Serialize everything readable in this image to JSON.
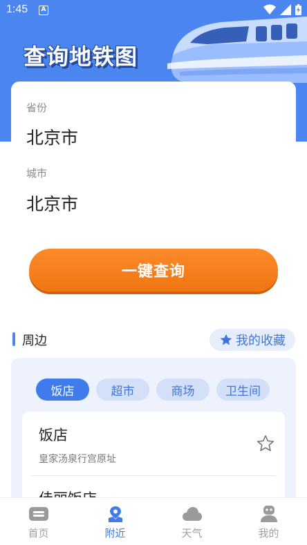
{
  "status_bar": {
    "time": "1:45",
    "a_label": "A"
  },
  "hero": {
    "title": "查询地铁图"
  },
  "form": {
    "province": {
      "label": "省份",
      "value": "北京市"
    },
    "city": {
      "label": "城市",
      "value": "北京市"
    },
    "query_button": "一键查询"
  },
  "nearby": {
    "title": "周边",
    "favorites_label": "我的收藏",
    "chips": [
      "饭店",
      "超市",
      "商场",
      "卫生间"
    ],
    "active_chip": "饭店",
    "items": [
      {
        "title": "饭店",
        "subtitle": "皇家汤泉行宫原址"
      },
      {
        "title": "佳丽饭店",
        "subtitle": ""
      }
    ]
  },
  "bottom_nav": {
    "items": [
      {
        "label": "首页",
        "icon": "home-icon"
      },
      {
        "label": "附近",
        "icon": "location-icon"
      },
      {
        "label": "天气",
        "icon": "cloud-icon"
      },
      {
        "label": "我的",
        "icon": "profile-icon"
      }
    ],
    "active": "附近"
  },
  "colors": {
    "primary": "#4b86f0",
    "accent": "#f5801a",
    "panel": "#edf2fc"
  }
}
